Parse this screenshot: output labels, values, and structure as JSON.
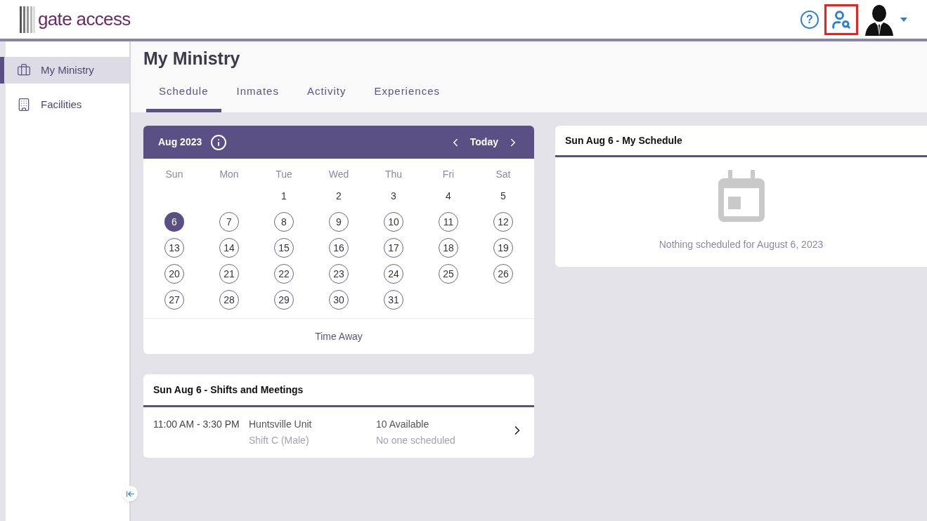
{
  "header": {
    "logo": "gate access",
    "help": "?",
    "user_search": {
      "highlighted": true
    }
  },
  "sidebar": {
    "items": [
      {
        "label": "My Ministry",
        "selected": true
      },
      {
        "label": "Facilities",
        "selected": false
      }
    ]
  },
  "page_title": "My Ministry",
  "tabs": [
    {
      "label": "Schedule",
      "selected": true
    },
    {
      "label": "Inmates",
      "selected": false
    },
    {
      "label": "Activity",
      "selected": false
    },
    {
      "label": "Experiences",
      "selected": false
    }
  ],
  "calendar": {
    "month": "Aug 2023",
    "today": "Today",
    "weekdays": [
      "Sun",
      "Mon",
      "Tue",
      "Wed",
      "Thu",
      "Fri",
      "Sat"
    ],
    "weeks": [
      [
        {
          "label": "1",
          "kind": "plain",
          "selected": false
        },
        {
          "label": "2",
          "kind": "plain",
          "selected": false
        },
        {
          "label": "3",
          "kind": "plain",
          "selected": false
        },
        {
          "label": "4",
          "kind": "plain",
          "selected": false
        },
        {
          "label": "5",
          "kind": "plain",
          "selected": false
        }
      ],
      [
        {
          "label": "6",
          "kind": "circle",
          "selected": true
        },
        {
          "label": "7",
          "kind": "circle",
          "selected": false
        },
        {
          "label": "8",
          "kind": "circle",
          "selected": false
        },
        {
          "label": "9",
          "kind": "circle",
          "selected": false
        },
        {
          "label": "10",
          "kind": "circle",
          "selected": false
        },
        {
          "label": "11",
          "kind": "circle",
          "selected": false
        },
        {
          "label": "12",
          "kind": "circle",
          "selected": false
        }
      ],
      [
        {
          "label": "13",
          "kind": "circle",
          "selected": false
        },
        {
          "label": "14",
          "kind": "circle",
          "selected": false
        },
        {
          "label": "15",
          "kind": "circle",
          "selected": false
        },
        {
          "label": "16",
          "kind": "circle",
          "selected": false
        },
        {
          "label": "17",
          "kind": "circle",
          "selected": false
        },
        {
          "label": "18",
          "kind": "circle",
          "selected": false
        },
        {
          "label": "19",
          "kind": "circle",
          "selected": false
        }
      ],
      [
        {
          "label": "20",
          "kind": "circle",
          "selected": false
        },
        {
          "label": "21",
          "kind": "circle",
          "selected": false
        },
        {
          "label": "22",
          "kind": "circle",
          "selected": false
        },
        {
          "label": "23",
          "kind": "circle",
          "selected": false
        },
        {
          "label": "24",
          "kind": "circle",
          "selected": false
        },
        {
          "label": "25",
          "kind": "circle",
          "selected": false
        },
        {
          "label": "26",
          "kind": "circle",
          "selected": false
        }
      ],
      [
        {
          "label": "27",
          "kind": "circle",
          "selected": false
        },
        {
          "label": "28",
          "kind": "circle",
          "selected": false
        },
        {
          "label": "29",
          "kind": "circle",
          "selected": false
        },
        {
          "label": "30",
          "kind": "circle",
          "selected": false
        },
        {
          "label": "31",
          "kind": "circle",
          "selected": false
        }
      ]
    ],
    "time_away": "Time Away"
  },
  "shifts": {
    "title": "Sun Aug 6 - Shifts and Meetings",
    "rows": [
      {
        "time": "11:00 AM - 3:30 PM",
        "place": "Huntsville Unit",
        "shift": "Shift C (Male)",
        "available": "10 Available",
        "scheduled": "No one scheduled"
      }
    ]
  },
  "my_schedule": {
    "title": "Sun Aug 6 - My Schedule",
    "empty": "Nothing scheduled for August 6, 2023"
  }
}
